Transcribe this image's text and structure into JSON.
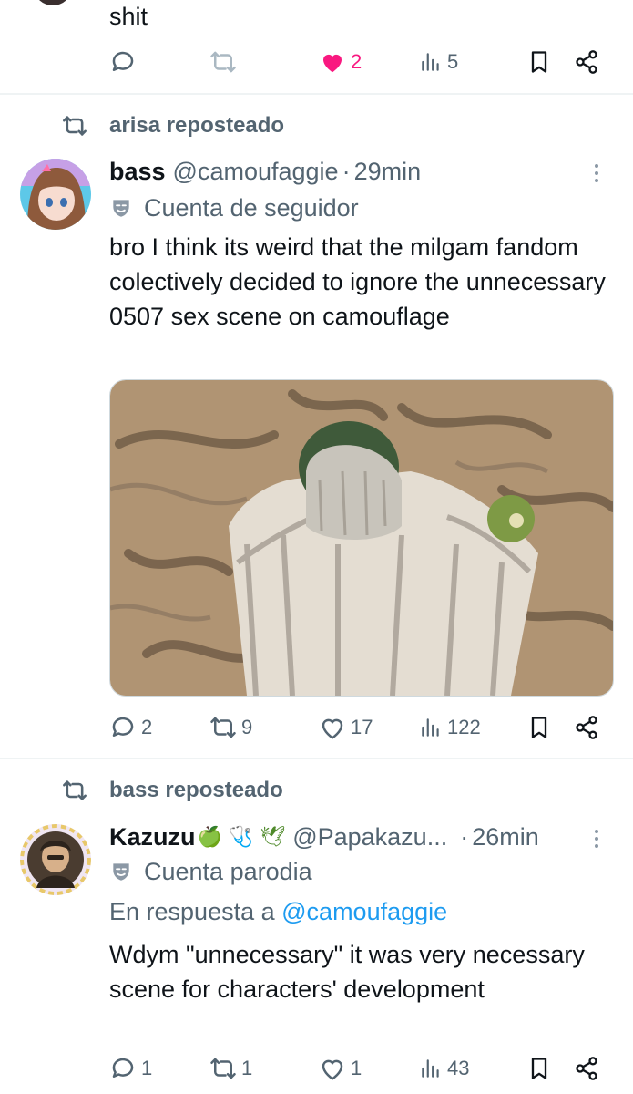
{
  "top_tweet": {
    "text": "shit",
    "actions": {
      "replies": "",
      "reposts": "",
      "likes": "2",
      "views": "5"
    }
  },
  "tweet1": {
    "reposted_by": "arisa reposteado",
    "name": "bass",
    "handle": "@camoufaggie",
    "separator": "·",
    "time": "29min",
    "label": "Cuenta de seguidor",
    "text": "bro I think its weird that the milgam fandom colectively decided to ignore the unnecessary 0507 sex scene on camouflage",
    "actions": {
      "replies": "2",
      "reposts": "9",
      "likes": "17",
      "views": "122"
    }
  },
  "tweet2": {
    "reposted_by": "bass reposteado",
    "name": "Kazuzu",
    "name_emojis": "🍏 🩺 🕊",
    "handle": "@Papakazu...",
    "separator": "·",
    "time": "26min",
    "label": "Cuenta parodia",
    "reply_prefix": "En respuesta a",
    "reply_to": "@camoufaggie",
    "text": "Wdym \"unnecessary\" it was very necessary scene for characters' development",
    "actions": {
      "replies": "1",
      "reposts": "1",
      "likes": "1",
      "views": "43"
    }
  },
  "colors": {
    "text": "#0f1419",
    "muted": "#536471",
    "like_active": "#f91880",
    "link": "#1d9bf0",
    "divider": "#eff3f4"
  },
  "icons": [
    "reply-icon",
    "repost-icon",
    "like-icon",
    "views-icon",
    "bookmark-icon",
    "share-icon",
    "more-icon",
    "mask-icon"
  ]
}
